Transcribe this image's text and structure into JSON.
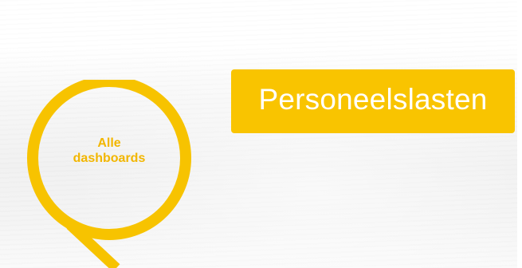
{
  "navigation": {
    "all_dashboards": {
      "line1": "Alle",
      "line2": "dashboards",
      "icon": "magnifier-ring-icon"
    }
  },
  "header": {
    "title": "Personeelslasten"
  },
  "colors": {
    "accent_yellow": "#f9c400",
    "ring_yellow": "#f7c300",
    "label_yellow": "#f2b600",
    "title_text": "#ffffff",
    "background": "#f3f3f3"
  }
}
